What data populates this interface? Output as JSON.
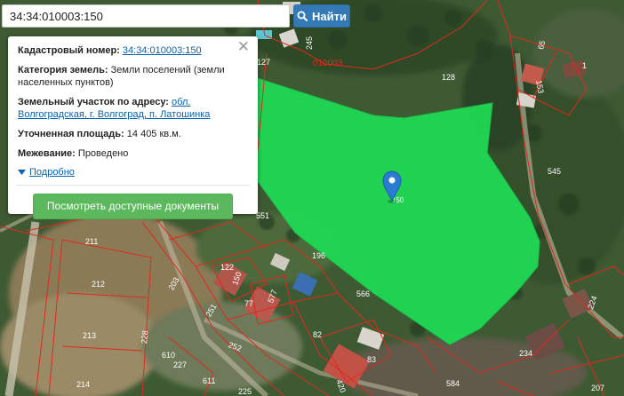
{
  "search": {
    "value": "34:34:010003:150",
    "button_label": "Найти"
  },
  "popup": {
    "cadastral_label": "Кадастровый номер:",
    "cadastral_value": "34:34:010003:150",
    "category_label": "Категория земель:",
    "category_value": "Земли поселений (земли населенных пунктов)",
    "address_label": "Земельный участок по адресу:",
    "address_value": "обл. Волгоградская, г. Волгоград, п. Латошинка",
    "area_label": "Уточненная площадь:",
    "area_value": "14 405 кв.м.",
    "survey_label": "Межевание:",
    "survey_value": "Проведено",
    "more_label": "Подробно",
    "docs_button": "Посмотреть доступные документы",
    "close_glyph": "✕"
  },
  "parcel_labels": {
    "p245": "245",
    "p127": "127",
    "p010003": "010003",
    "p128": "128",
    "p65": "65",
    "p1": "1",
    "p153": "153",
    "p545": "545",
    "p551": "551",
    "p211": "211",
    "p196": "196",
    "p122": "122",
    "p150": "150",
    "p566": "566",
    "p212": "212",
    "p77": "77",
    "p577": "577",
    "p203": "203",
    "p251": "251",
    "p213": "213",
    "p82": "82",
    "p228": "228",
    "p252": "252",
    "p610": "610",
    "p227": "227",
    "p83": "83",
    "p234": "234",
    "p224": "224",
    "p214": "214",
    "p611": "611",
    "p225": "225",
    "p420": "420",
    "p584": "584",
    "p207": "207",
    "p150m": "150"
  },
  "colors": {
    "parcel_fill": "#1fdc55",
    "boundary": "#e2281f",
    "marker": "#2a7bd3"
  },
  "icons": {
    "search": "search-icon",
    "close": "close-icon",
    "marker": "map-marker-icon",
    "toggle": "caret-down-icon"
  }
}
